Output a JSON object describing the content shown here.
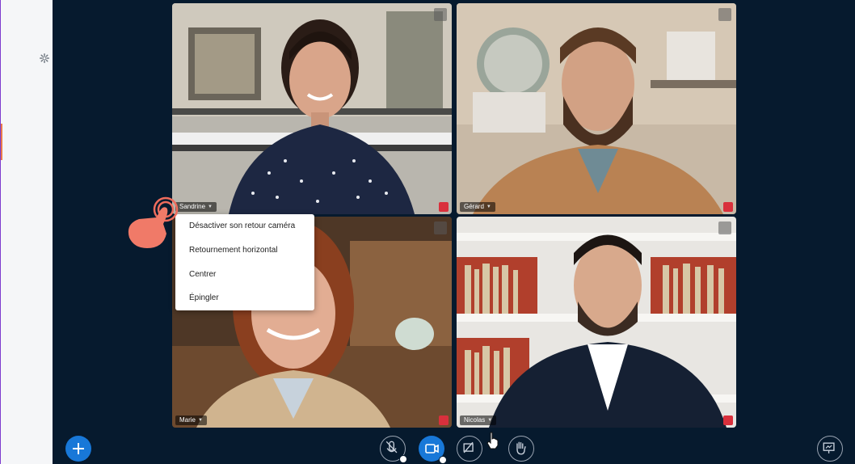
{
  "sidebar": {
    "settings_icon": "gear-icon",
    "accent_color": "#e9794a"
  },
  "participants": [
    {
      "name": "Sandrine",
      "muted": true
    },
    {
      "name": "Gérard",
      "muted": true
    },
    {
      "name": "Marie",
      "muted": true
    },
    {
      "name": "Nicolas",
      "muted": true
    }
  ],
  "context_menu": {
    "items": [
      "Désactiver son retour caméra",
      "Retournement horizontal",
      "Centrer",
      "Épingler"
    ]
  },
  "toolbar": {
    "add_icon": "plus-icon",
    "mic_icon": "microphone-muted-icon",
    "camera_icon": "camera-icon",
    "screen_icon": "screen-share-off-icon",
    "hand_icon": "raise-hand-icon",
    "present_icon": "presentation-icon"
  },
  "colors": {
    "background": "#061a2e",
    "accent_blue": "#1878d8",
    "muted_red": "#d9303c"
  }
}
